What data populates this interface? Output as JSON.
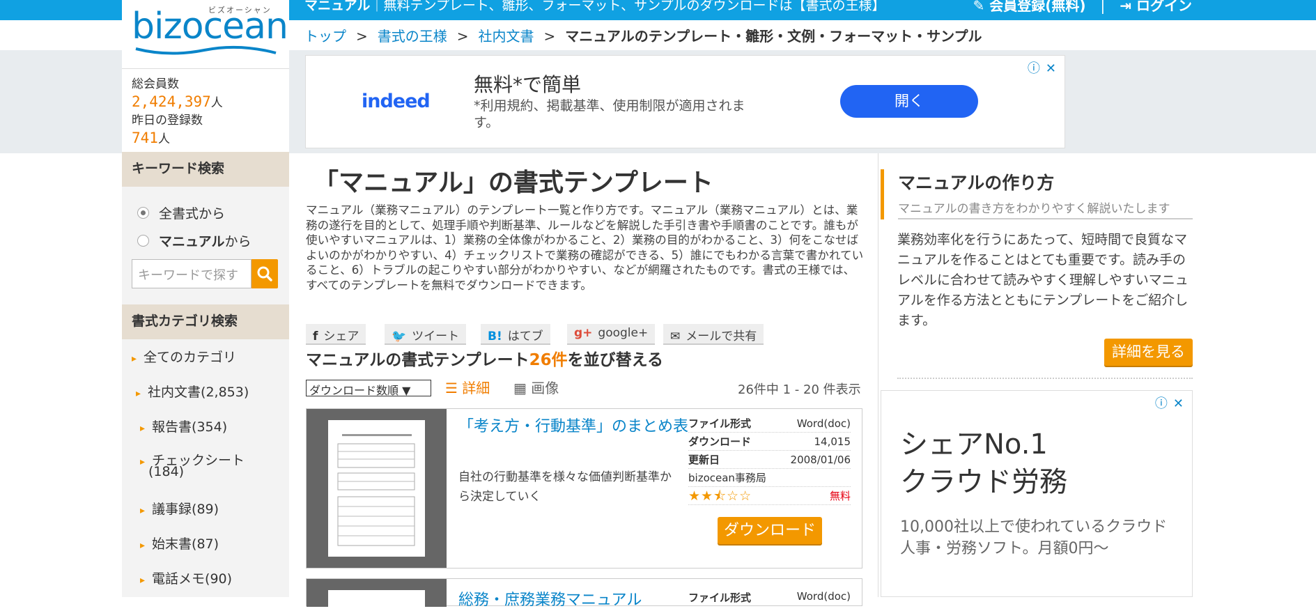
{
  "topbar": {
    "tag_bold": "マニュアル",
    "tag_rest": "｜無料テンプレート、雛形、フォーマット、サンプルのダウンロードは【書式の王様】",
    "register": "会員登録(無料)",
    "separator": "|",
    "login": "ログイン"
  },
  "logo": {
    "ruby": "ビズオーシャン",
    "word": "bizocean"
  },
  "members": {
    "total_label": "総会員数",
    "total": "2,424,397",
    "unit": "人",
    "yesterday_label": "昨日の登録数",
    "yesterday": "741"
  },
  "keyword_search": {
    "heading": "キーワード検索",
    "option_all": "全書式から",
    "option_bold": "マニュアル",
    "option_suffix": "から",
    "placeholder": "キーワードで探す"
  },
  "category": {
    "heading": "書式カテゴリ検索",
    "items": [
      "全てのカテゴリ",
      "社内文書(2,853)",
      "報告書(354)",
      "チェックシート",
      "(184)",
      "議事録(89)",
      "始末書(87)",
      "電話メモ(90)"
    ]
  },
  "breadcrumb": {
    "items": [
      "トップ",
      "書式の王様",
      "社内文書"
    ],
    "sep": ">",
    "current": "マニュアルのテンプレート・雛形・文例・フォーマット・サンプル"
  },
  "ad_top": {
    "brand": "indeed",
    "headline": "無料*で簡単",
    "sub": "*利用規約、掲載基準、使用制限が適用されます。",
    "button": "開く",
    "info": "ⓘ",
    "close": "✕"
  },
  "main": {
    "title": "「マニュアル」の書式テンプレート",
    "description": "マニュアル（業務マニュアル）のテンプレート一覧と作り方です。マニュアル（業務マニュアル）とは、業務の遂行を目的として、処理手順や判断基準、ルールなどを解説した手引き書や手順書のことです。誰もが使いやすいマニュアルは、1）業務の全体像がわかること、2）業務の目的がわかること、3）何をこなせばよいのかがわかりやすい、4）チェックリストで業務の確認ができる、5）誰にでもわかる言葉で書かれていること、6）トラブルの起こりやすい部分がわかりやすい、などが網羅されたものです。書式の王様では、すべてのテンプレートを無料でダウンロードできます。",
    "share": {
      "facebook_icon": "f",
      "facebook": "シェア",
      "twitter_icon": "🐦",
      "twitter": "ツイート",
      "hatena_icon": "B!",
      "hatena": "はてブ",
      "google_icon": "g+",
      "google": "google+",
      "mail_icon": "✉",
      "mail": "メールで共有"
    },
    "sub_title_pre": "マニュアルの書式テンプレート",
    "count": "26件",
    "sub_title_post": "を並び替える",
    "sort_selected": "ダウンロード数順",
    "view_detail": "詳細",
    "view_image": "画像",
    "range": "26件中 1 - 20 件表示"
  },
  "items": [
    {
      "title": "「考え方・行動基準」のまとめ表",
      "text": "自社の行動基準を様々な価値判断基準から決定していく",
      "format_label": "ファイル形式",
      "format": "Word(doc)",
      "downloads_label": "ダウンロード",
      "downloads": "14,015",
      "updated_label": "更新日",
      "updated": "2008/01/06",
      "author": "bizocean事務局",
      "rating": 2.5,
      "stars": "★★⯪☆☆",
      "price": "無料",
      "button": "ダウンロード"
    },
    {
      "title": "総務・庶務業務マニュアル",
      "format_label": "ファイル形式",
      "format": "Word(doc)"
    }
  ],
  "right": {
    "title": "マニュアルの作り方",
    "subtitle": "マニュアルの書き方をわかりやすく解説いたします",
    "body": "業務効率化を行うにあたって、短時間で良質なマニュアルを作ることはとても重要です。読み手のレベルに合わせて読みやすく理解しやすいマニュアルを作る方法とともにテンプレートをご紹介します。",
    "button": "詳細を見る"
  },
  "ad_right": {
    "headline_1": "シェアNo.1",
    "headline_2": "クラウド労務",
    "sub": "10,000社以上で使われているクラウド人事・労務ソフト。月額0円〜",
    "info": "ⓘ",
    "close": "✕"
  },
  "colors": {
    "accent": "#f39800",
    "link": "#0a85c9",
    "topbar": "#10a1e2"
  }
}
